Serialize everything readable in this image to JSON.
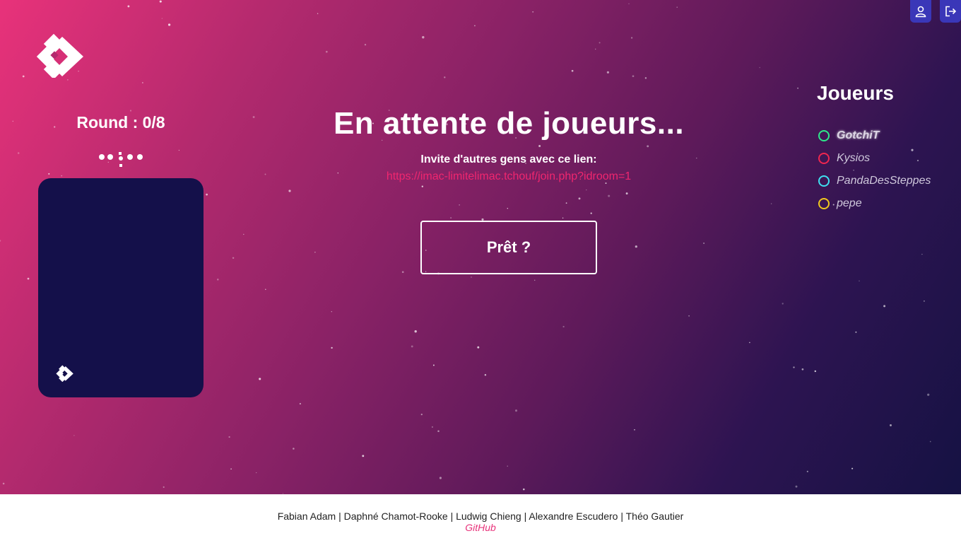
{
  "header": {
    "profile_icon": "user-icon",
    "logout_icon": "logout-icon",
    "button_color": "#3a37b8"
  },
  "game": {
    "round_text": "Round : 0/8",
    "title": "En attente de joueurs...",
    "invite_text": "Invite d'autres gens avec ce lien:",
    "invite_link": "https://imac-limitelimac.tchouf/join.php?idroom=1",
    "ready_label": "Prêt ?"
  },
  "players": {
    "title": "Joueurs",
    "items": [
      {
        "name": "GotchiT",
        "color": "#2ee88a",
        "current": true
      },
      {
        "name": "Kysios",
        "color": "#f0264f",
        "current": false
      },
      {
        "name": "PandaDesSteppes",
        "color": "#3fe0f0",
        "current": false
      },
      {
        "name": "pepe",
        "color": "#f0c81e",
        "current": false
      }
    ]
  },
  "footer": {
    "credits": "Fabian Adam | Daphné Chamot-Rooke | Ludwig Chieng | Alexandre Escudero | Théo Gautier",
    "github_label": "GitHub"
  },
  "colors": {
    "card": "#14104a",
    "link": "#f0266f",
    "gradient_start": "#e8327a",
    "gradient_end": "#151243"
  }
}
